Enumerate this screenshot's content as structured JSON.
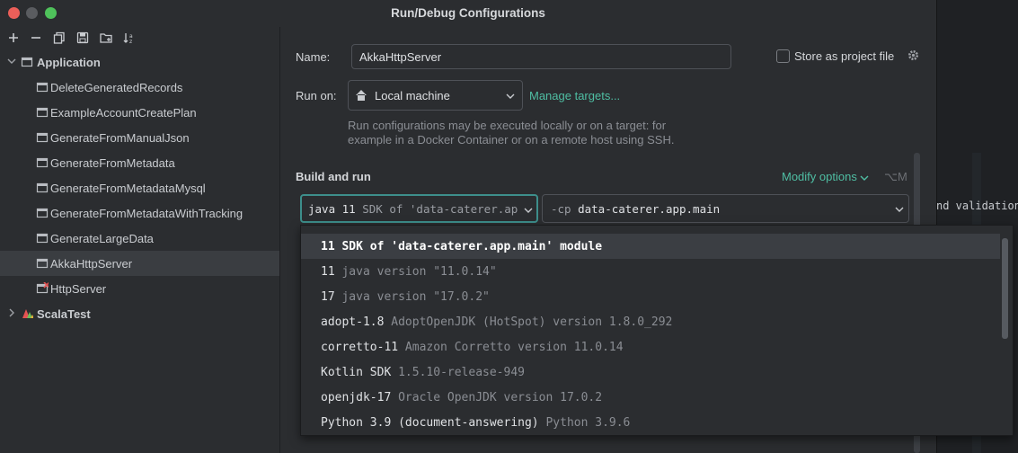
{
  "window": {
    "title": "Run/Debug Configurations"
  },
  "background": {
    "text": "nd validation"
  },
  "tree": {
    "root": {
      "label": "Application",
      "expanded": true
    },
    "items": [
      {
        "label": "DeleteGeneratedRecords"
      },
      {
        "label": "ExampleAccountCreatePlan"
      },
      {
        "label": "GenerateFromManualJson"
      },
      {
        "label": "GenerateFromMetadata"
      },
      {
        "label": "GenerateFromMetadataMysql"
      },
      {
        "label": "GenerateFromMetadataWithTracking"
      },
      {
        "label": "GenerateLargeData"
      },
      {
        "label": "AkkaHttpServer",
        "selected": true
      },
      {
        "label": "HttpServer",
        "error": true
      }
    ],
    "second_root": {
      "label": "ScalaTest",
      "expanded": false
    }
  },
  "form": {
    "name_label": "Name:",
    "name_value": "AkkaHttpServer",
    "store_label": "Store as project file",
    "run_on_label": "Run on:",
    "run_on_value": "Local machine",
    "manage_targets": "Manage targets...",
    "run_on_hint": "Run configurations may be executed locally or on a target: for example in a Docker Container or on a remote host using SSH.",
    "build_and_run": "Build and run",
    "modify_options": "Modify options",
    "modify_shortcut": "⌥M",
    "jdk_prefix": "java 11",
    "jdk_value": "SDK of 'data-caterer.ap",
    "cp_prefix": "-cp",
    "cp_value": "data-caterer.app.main"
  },
  "jdk_options": [
    {
      "name": "11 SDK of 'data-caterer.app.main' module",
      "version": "",
      "selected": true
    },
    {
      "name": "11",
      "version": "java version \"11.0.14\""
    },
    {
      "name": "17",
      "version": "java version \"17.0.2\""
    },
    {
      "name": "adopt-1.8",
      "version": "AdoptOpenJDK (HotSpot) version 1.8.0_292"
    },
    {
      "name": "corretto-11",
      "version": "Amazon Corretto version 11.0.14"
    },
    {
      "name": "Kotlin SDK",
      "version": "1.5.10-release-949"
    },
    {
      "name": "openjdk-17",
      "version": "Oracle OpenJDK version 17.0.2"
    },
    {
      "name": "Python 3.9 (document-answering)",
      "version": "Python 3.9.6"
    }
  ],
  "colors": {
    "accent_link": "#4fbea3",
    "focus_border": "#3d8e8b",
    "error": "#e55353"
  }
}
